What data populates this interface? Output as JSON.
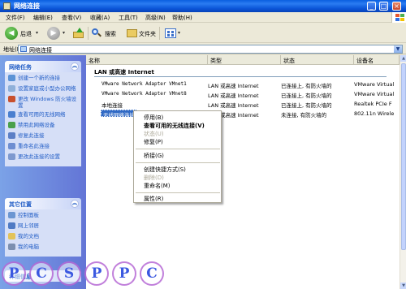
{
  "window": {
    "title": "网络连接",
    "min": "_",
    "max": "□",
    "close": "×"
  },
  "menu": [
    "文件(F)",
    "编辑(E)",
    "查看(V)",
    "收藏(A)",
    "工具(T)",
    "高级(N)",
    "帮助(H)"
  ],
  "toolbar": {
    "back": "后退",
    "search": "搜索",
    "folders": "文件夹"
  },
  "address": {
    "label": "地址(D)",
    "value": "网络连接"
  },
  "left_pane": {
    "tasks": {
      "title": "网络任务",
      "items": [
        "创建一个新的连接",
        "设置家庭或小型办公网络",
        "更改 Windows 防火墙设置",
        "查看可用的无线网络",
        "禁用此网络设备",
        "修复此连接",
        "重命名此连接",
        "更改此连接的设置"
      ]
    },
    "other_places": {
      "title": "其它位置",
      "items": [
        "控制面板",
        "网上邻居",
        "我的文档",
        "我的电脑"
      ]
    },
    "details_title": "详细信息"
  },
  "columns": [
    "名称",
    "类型",
    "状态",
    "设备名"
  ],
  "group_title": "LAN 或高速 Internet",
  "connections": [
    {
      "name": "VMware Network Adapter VMnet1",
      "type": "LAN 或高速 Internet",
      "status": "已连接上, 有防火墙的",
      "device": "VMware Virtual"
    },
    {
      "name": "VMware Network Adapter VMnet8",
      "type": "LAN 或高速 Internet",
      "status": "已连接上, 有防火墙的",
      "device": "VMware Virtual"
    },
    {
      "name": "本地连接",
      "type": "LAN 或高速 Internet",
      "status": "已连接上, 有防火墙的",
      "device": "Realtek PCIe F"
    },
    {
      "name": "无线网络连接",
      "type": "LAN 或高速 Internet",
      "status": "未连接, 有防火墙的",
      "device": "802.11n Wirele"
    }
  ],
  "context_menu": {
    "items": [
      "停用(B)",
      "查看可用的无线连接(V)",
      "状态(U)",
      "修复(P)",
      "桥接(G)",
      "创建快捷方式(S)",
      "删除(D)",
      "重命名(M)",
      "属性(R)"
    ]
  },
  "watermark": [
    "P",
    "C",
    "S",
    "P",
    "P",
    "C"
  ],
  "colors": {
    "title_blue": "#0b55d8",
    "selection": "#316ac5",
    "link_blue": "#215dc6",
    "pane_blue": "#7ba2e7"
  }
}
